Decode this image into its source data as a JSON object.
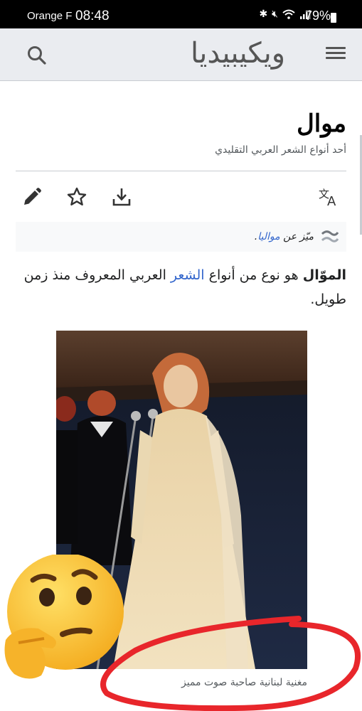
{
  "status_bar": {
    "carrier": "Orange F",
    "time": "08:48",
    "battery": "79%"
  },
  "header": {
    "logo": "ويكيبيديا",
    "search_icon": "search-icon",
    "menu_icon": "menu-icon"
  },
  "article": {
    "title": "موال",
    "subtitle": "أحد أنواع الشعر العربي التقليدي",
    "toolbar": [
      "edit-icon",
      "star-icon",
      "download-icon",
      "language-icon"
    ],
    "hatnote_prefix": "ميّز عن",
    "hatnote_link": "مواليا",
    "hatnote_suffix": ".",
    "para_bold": "الموّال",
    "para_part1": "هو نوع من أنواع",
    "para_link": "الشعر",
    "para_part2": "العربي المعروف منذ زمن طويل.",
    "caption": "مغنية لبنانية صاحبة صوت مميز"
  },
  "colors": {
    "link": "#3366cc",
    "header_bg": "#eaecf0",
    "annotation": "#e8262b"
  },
  "overlay": {
    "emoji": "thinking-face-emoji"
  }
}
